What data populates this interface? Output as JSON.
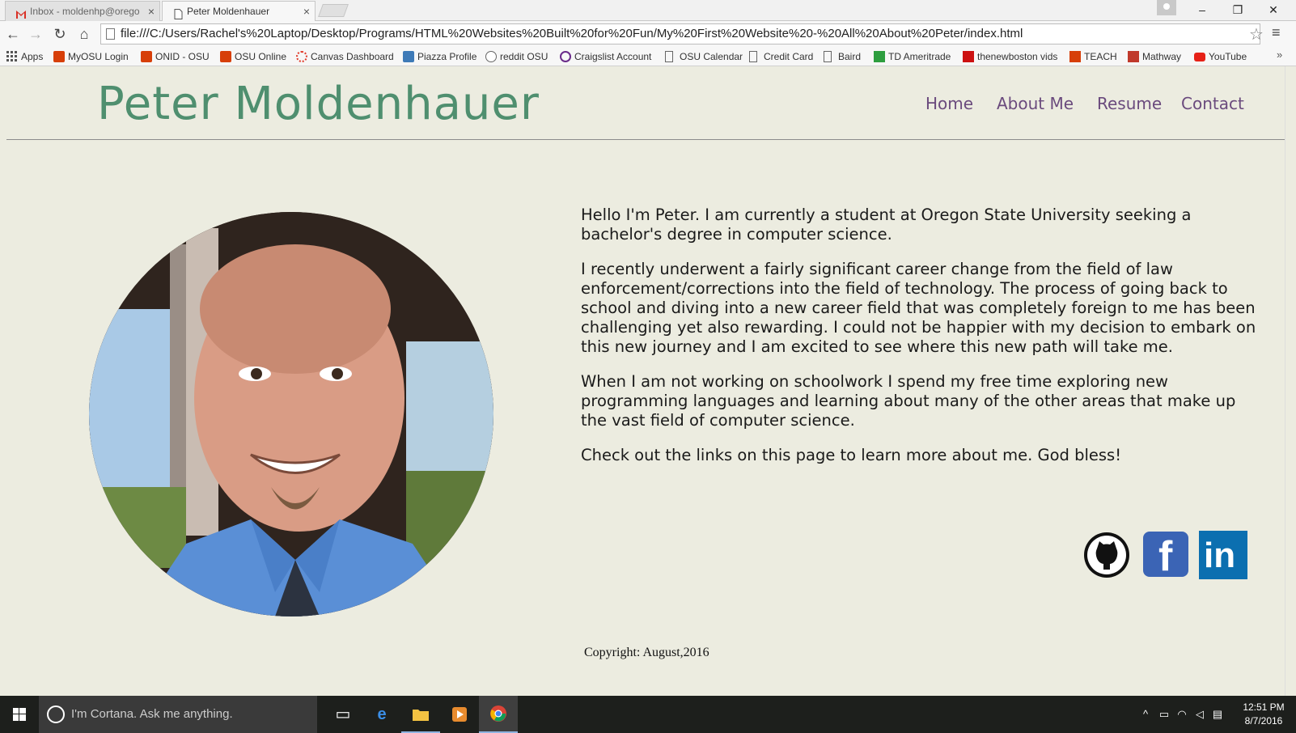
{
  "browser": {
    "tabs": [
      {
        "title": "Inbox - moldenhp@orego",
        "active": false
      },
      {
        "title": "Peter Moldenhauer",
        "active": true
      }
    ],
    "url": "file:///C:/Users/Rachel's%20Laptop/Desktop/Programs/HTML%20Websites%20Built%20for%20Fun/My%20First%20Website%20-%20All%20About%20Peter/index.html",
    "bookmarks": [
      "Apps",
      "MyOSU Login",
      "ONID - OSU",
      "OSU Online",
      "Canvas Dashboard",
      "Piazza Profile",
      "reddit OSU",
      "Craigslist Account",
      "OSU Calendar",
      "Credit Card",
      "Baird",
      "TD Ameritrade",
      "thenewboston vids",
      "TEACH",
      "Mathway",
      "YouTube"
    ],
    "more_label": "»",
    "window_buttons": {
      "minimize": "–",
      "restore": "❐",
      "close": "✕"
    }
  },
  "site": {
    "title": "Peter Moldenhauer",
    "nav": [
      "Home",
      "About Me",
      "Resume",
      "Contact"
    ],
    "bio": [
      "Hello I'm Peter. I am currently a student at Oregon State University seeking a bachelor's degree in computer science.",
      "I recently underwent a fairly significant career change from the field of law enforcement/corrections into the field of technology. The process of going back to school and diving into a new career field that was completely foreign to me has been challenging yet also rewarding. I could not be happier with my decision to embark on this new journey and I am excited to see where this new path will take me.",
      "When I am not working on schoolwork I spend my free time exploring new programming languages and learning about many of the other areas that make up the vast field of computer science.",
      "Check out the links on this page to learn more about me. God bless!"
    ],
    "social": [
      {
        "name": "github",
        "icon": "github-icon"
      },
      {
        "name": "facebook",
        "icon": "facebook-icon",
        "glyph": "f"
      },
      {
        "name": "linkedin",
        "icon": "linkedin-icon",
        "glyph": "in"
      }
    ],
    "copyright": "Copyright: August,2016",
    "colors": {
      "title": "#4f8f6f",
      "nav": "#6a4a7d",
      "background": "#ecece0"
    }
  },
  "taskbar": {
    "search_placeholder": "I'm Cortana. Ask me anything.",
    "time": "12:51 PM",
    "date": "8/7/2016"
  }
}
